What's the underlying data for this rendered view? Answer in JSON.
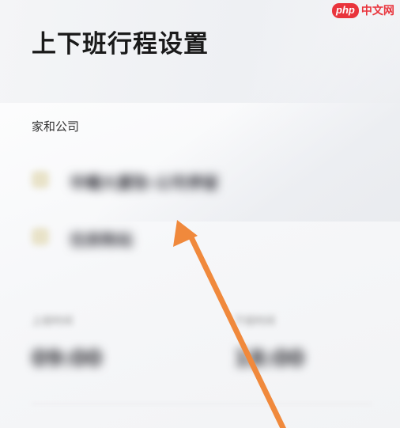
{
  "page": {
    "title": "上下班行程设置",
    "section_label": "家和公司"
  },
  "rows": [
    {
      "text": "华耀大厦取-公司停留",
      "icon": "home-icon"
    },
    {
      "text": "住房购站",
      "icon": "office-icon"
    }
  ],
  "times": {
    "start_label": "上班时间",
    "start_value": "09:00",
    "end_label": "下班时间",
    "end_value": "18:00"
  },
  "watermark": {
    "badge": "php",
    "text": "中文网"
  },
  "colors": {
    "arrow": "#f0893c",
    "watermark": "#e9343c"
  }
}
